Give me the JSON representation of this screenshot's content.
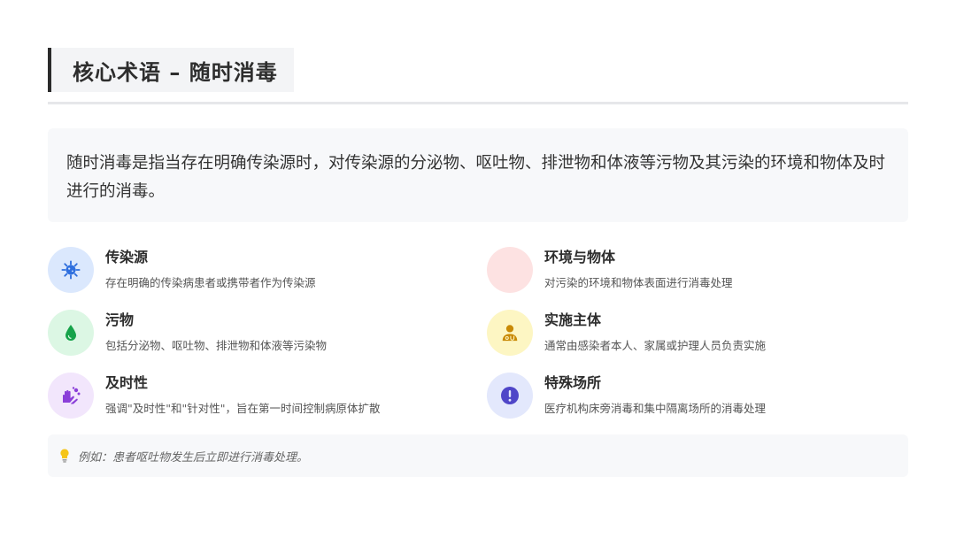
{
  "header": {
    "title": "核心术语 – 随时消毒"
  },
  "definition": {
    "text": "随时消毒是指当存在明确传染源时，对传染源的分泌物、呕吐物、排泄物和体液等污物及其污染的环境和物体及时进行的消毒。"
  },
  "items": [
    {
      "name": "传染源",
      "desc": "存在明确的传染病患者或携带者作为传染源",
      "icon": "virus-icon",
      "circle_color": "#dbe8fd",
      "icon_color": "#2f6fde"
    },
    {
      "name": "环境与物体",
      "desc": "对污染的环境和物体表面进行消毒处理",
      "icon": "blank-icon",
      "circle_color": "#fde2e2",
      "icon_color": "#e04b4b"
    },
    {
      "name": "污物",
      "desc": "包括分泌物、呕吐物、排泄物和体液等污染物",
      "icon": "droplet-icon",
      "circle_color": "#dcf7e4",
      "icon_color": "#16a34a"
    },
    {
      "name": "实施主体",
      "desc": "通常由感染者本人、家属或护理人员负责实施",
      "icon": "doctor-icon",
      "circle_color": "#fdf6c3",
      "icon_color": "#c98a06"
    },
    {
      "name": "及时性",
      "desc": "强调\"及时性\"和\"针对性\"，旨在第一时间控制病原体扩散",
      "icon": "hand-wash-icon",
      "circle_color": "#f2e6fc",
      "icon_color": "#8b3fd9"
    },
    {
      "name": "特殊场所",
      "desc": "医疗机构床旁消毒和集中隔离场所的消毒处理",
      "icon": "exclamation-circle-icon",
      "circle_color": "#e3e8fc",
      "icon_color": "#4f46c8"
    }
  ],
  "example": {
    "icon": "lightbulb-icon",
    "icon_color": "#f5c518",
    "text": "例如：患者呕吐物发生后立即进行消毒处理。"
  }
}
